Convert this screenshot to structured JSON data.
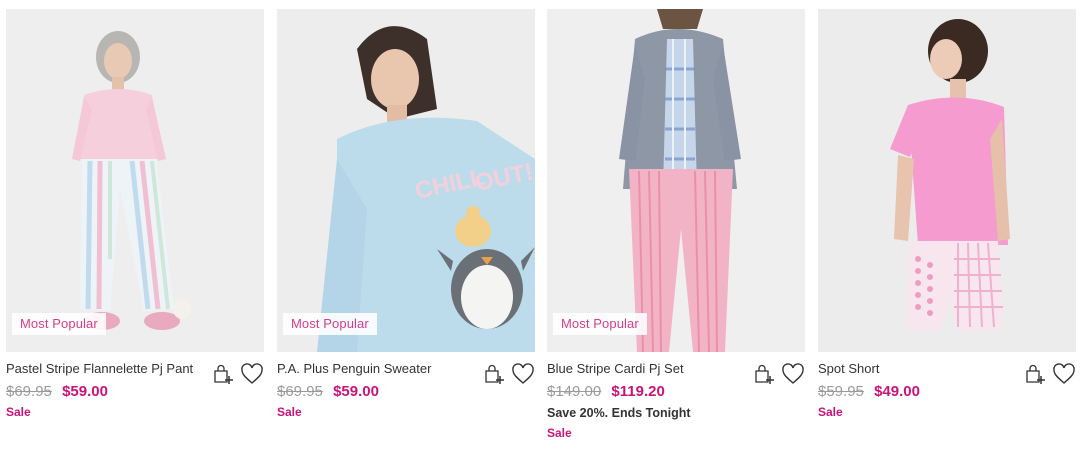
{
  "badge_label": "Most Popular",
  "colors": {
    "accent": "#c8147a",
    "badge_text": "#d63e8b",
    "was_price": "#9a9a9a",
    "text": "#333333"
  },
  "icons": {
    "add_to_bag": "shopping-bag-plus-icon",
    "wishlist": "heart-icon"
  },
  "products": [
    {
      "name": "Pastel Stripe Flannelette Pj Pant",
      "was_price": "$69.95",
      "now_price": "$59.00",
      "promo": "",
      "sale": "Sale",
      "badge": "Most Popular",
      "image_alt": "Woman in pink top and pastel striped flannelette pyjama pants"
    },
    {
      "name": "P.A. Plus Penguin Sweater",
      "was_price": "$69.95",
      "now_price": "$59.00",
      "promo": "",
      "sale": "Sale",
      "badge": "Most Popular",
      "image_alt": "Woman in light blue penguin print sweater"
    },
    {
      "name": "Blue Stripe Cardi Pj Set",
      "was_price": "$149.00",
      "now_price": "$119.20",
      "promo": "Save 20%. Ends Tonight",
      "sale": "Sale",
      "badge": "Most Popular",
      "image_alt": "Woman in blue check cardigan and pink striped pyjama pants"
    },
    {
      "name": "Spot Short",
      "was_price": "$59.95",
      "now_price": "$49.00",
      "promo": "",
      "sale": "Sale",
      "badge": "",
      "image_alt": "Woman in pink tee and pink spot shorts"
    }
  ]
}
